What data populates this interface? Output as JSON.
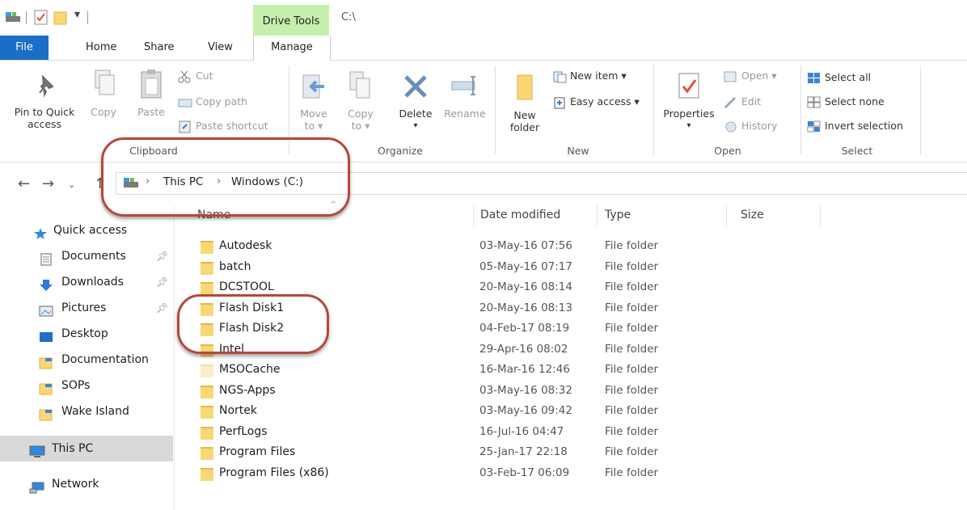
{
  "titlebar": {
    "context_tab": "Drive Tools",
    "path": "C:\\"
  },
  "tabs": [
    {
      "label": "File"
    },
    {
      "label": "Home"
    },
    {
      "label": "Share"
    },
    {
      "label": "View"
    },
    {
      "label": "Manage"
    }
  ],
  "ribbon": {
    "clipboard": {
      "pin": "Pin to Quick access",
      "copy": "Copy",
      "paste": "Paste",
      "cut": "Cut",
      "copy_path": "Copy path",
      "paste_shortcut": "Paste shortcut",
      "label": "Clipboard"
    },
    "organize": {
      "move_to": "Move to",
      "copy_to": "Copy to",
      "delete": "Delete",
      "rename": "Rename",
      "label": "Organize"
    },
    "new": {
      "new_folder": "New folder",
      "new_item": "New item",
      "easy_access": "Easy access",
      "label": "New"
    },
    "open": {
      "properties": "Properties",
      "open": "Open",
      "edit": "Edit",
      "history": "History",
      "label": "Open"
    },
    "select": {
      "select_all": "Select all",
      "select_none": "Select none",
      "invert": "Invert selection",
      "label": "Select"
    }
  },
  "breadcrumb": [
    "This PC",
    "Windows (C:)"
  ],
  "sidebar": {
    "items": [
      {
        "label": "Quick access",
        "icon": "star-icon",
        "pinned": false
      },
      {
        "label": "Documents",
        "icon": "documents-icon",
        "pinned": true
      },
      {
        "label": "Downloads",
        "icon": "download-arrow-icon",
        "pinned": true
      },
      {
        "label": "Pictures",
        "icon": "pictures-icon",
        "pinned": true
      },
      {
        "label": "Desktop",
        "icon": "desktop-icon",
        "pinned": false
      },
      {
        "label": "Documentation",
        "icon": "folder-icon",
        "pinned": false
      },
      {
        "label": "SOPs",
        "icon": "folder-icon",
        "pinned": false
      },
      {
        "label": "Wake Island",
        "icon": "folder-icon",
        "pinned": false
      },
      {
        "label": "This PC",
        "icon": "computer-icon",
        "pinned": false
      },
      {
        "label": "Network",
        "icon": "network-icon",
        "pinned": false
      }
    ]
  },
  "columns": {
    "name": "Name",
    "date": "Date modified",
    "type": "Type",
    "size": "Size"
  },
  "files": [
    {
      "name": "Autodesk",
      "date": "03-May-16 07:56",
      "type": "File folder"
    },
    {
      "name": "batch",
      "date": "05-May-16 07:17",
      "type": "File folder"
    },
    {
      "name": "DCSTOOL",
      "date": "20-May-16 08:14",
      "type": "File folder"
    },
    {
      "name": "Flash Disk1",
      "date": "20-May-16 08:13",
      "type": "File folder"
    },
    {
      "name": "Flash Disk2",
      "date": "04-Feb-17 08:19",
      "type": "File folder"
    },
    {
      "name": "Intel",
      "date": "29-Apr-16 08:02",
      "type": "File folder"
    },
    {
      "name": "MSOCache",
      "date": "16-Mar-16 12:46",
      "type": "File folder"
    },
    {
      "name": "NGS-Apps",
      "date": "03-May-16 08:32",
      "type": "File folder"
    },
    {
      "name": "Nortek",
      "date": "03-May-16 09:42",
      "type": "File folder"
    },
    {
      "name": "PerfLogs",
      "date": "16-Jul-16 04:47",
      "type": "File folder"
    },
    {
      "name": "Program Files",
      "date": "25-Jan-17 22:18",
      "type": "File folder"
    },
    {
      "name": "Program Files (x86)",
      "date": "03-Feb-17 06:09",
      "type": "File folder"
    }
  ],
  "colors": {
    "file_tab": "#1a6ec8",
    "drive_tools": "#c6efae",
    "annotation": "#b5483a",
    "folder": "#f8d775"
  }
}
